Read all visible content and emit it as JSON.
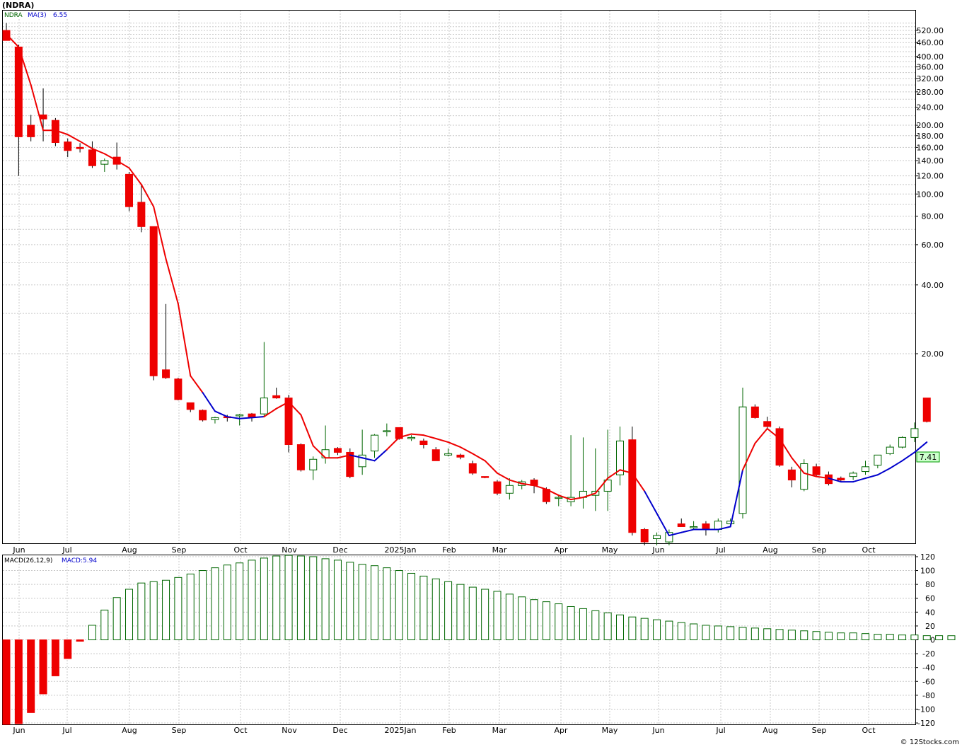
{
  "chart_data": [
    {
      "type": "candlestick",
      "ticker_title": "(NDRA)",
      "legend": {
        "symbol": "NDRA",
        "ma_label": "MA(3)",
        "ma_value": "6.55"
      },
      "last_price_label": "7.41",
      "y_scale": "log",
      "y_ticks": [
        "520.00",
        "460.00",
        "400.00",
        "360.00",
        "320.00",
        "280.00",
        "240.00",
        "200.00",
        "180.00",
        "160.00",
        "140.00",
        "120.00",
        "100.00",
        "80.00",
        "60.00",
        "40.00",
        "20.00"
      ],
      "month_labels": [
        "Jun",
        "Jul",
        "Aug",
        "Sep",
        "Oct",
        "Nov",
        "Dec",
        "2025Jan",
        "Feb",
        "Mar",
        "Apr",
        "May",
        "Jun",
        "Jul",
        "Aug",
        "Sep",
        "Oct"
      ],
      "colors": {
        "up": "#ffffff",
        "up_border": "#006600",
        "down": "#ee0000",
        "ma_down": "#ee0000",
        "ma_up": "#0000cc",
        "grid": "#c8c8c8"
      },
      "candles": [
        {
          "week": 0,
          "o": 520,
          "h": 560,
          "l": 470,
          "c": 470
        },
        {
          "week": 1,
          "o": 440,
          "h": 450,
          "l": 120,
          "c": 178
        },
        {
          "week": 2,
          "o": 200,
          "h": 222,
          "l": 170,
          "c": 178
        },
        {
          "week": 3,
          "o": 222,
          "h": 290,
          "l": 170,
          "c": 213
        },
        {
          "week": 4,
          "o": 210,
          "h": 215,
          "l": 162,
          "c": 168
        },
        {
          "week": 5,
          "o": 169,
          "h": 175,
          "l": 145,
          "c": 155
        },
        {
          "week": 6,
          "o": 160,
          "h": 167,
          "l": 152,
          "c": 158
        },
        {
          "week": 7,
          "o": 156,
          "h": 170,
          "l": 130,
          "c": 133
        },
        {
          "week": 8,
          "o": 135,
          "h": 143,
          "l": 125,
          "c": 140
        },
        {
          "week": 9,
          "o": 145,
          "h": 168,
          "l": 128,
          "c": 135
        },
        {
          "week": 10,
          "o": 122,
          "h": 125,
          "l": 84,
          "c": 88
        },
        {
          "week": 11,
          "o": 92,
          "h": 110,
          "l": 68,
          "c": 72
        },
        {
          "week": 12,
          "o": 72,
          "h": 72,
          "l": 15.3,
          "c": 16
        },
        {
          "week": 13,
          "o": 17,
          "h": 33,
          "l": 15.5,
          "c": 15.7
        },
        {
          "week": 14,
          "o": 15.5,
          "h": 15.7,
          "l": 12.5,
          "c": 12.6
        },
        {
          "week": 15,
          "o": 12.2,
          "h": 12.2,
          "l": 11.1,
          "c": 11.4
        },
        {
          "week": 16,
          "o": 11.3,
          "h": 11.4,
          "l": 10.1,
          "c": 10.25
        },
        {
          "week": 17,
          "o": 10.3,
          "h": 10.6,
          "l": 9.9,
          "c": 10.5
        },
        {
          "week": 18,
          "o": 10.6,
          "h": 10.8,
          "l": 10.1,
          "c": 10.5
        },
        {
          "week": 19,
          "o": 10.7,
          "h": 10.9,
          "l": 9.7,
          "c": 10.8
        },
        {
          "week": 20,
          "o": 10.9,
          "h": 11.0,
          "l": 10.1,
          "c": 10.5
        },
        {
          "week": 21,
          "o": 10.9,
          "h": 22.5,
          "l": 10.6,
          "c": 12.8
        },
        {
          "week": 22,
          "o": 13.1,
          "h": 14.2,
          "l": 12.7,
          "c": 12.8
        },
        {
          "week": 23,
          "o": 12.8,
          "h": 13.2,
          "l": 7.4,
          "c": 8.0
        },
        {
          "week": 24,
          "o": 8.0,
          "h": 8.1,
          "l": 6.1,
          "c": 6.2
        },
        {
          "week": 25,
          "o": 6.2,
          "h": 7.1,
          "l": 5.6,
          "c": 6.9
        },
        {
          "week": 26,
          "o": 7.0,
          "h": 9.7,
          "l": 6.6,
          "c": 7.6
        },
        {
          "week": 27,
          "o": 7.7,
          "h": 7.8,
          "l": 7.2,
          "c": 7.4
        },
        {
          "week": 28,
          "o": 7.4,
          "h": 7.7,
          "l": 5.7,
          "c": 5.8
        },
        {
          "week": 29,
          "o": 6.4,
          "h": 9.3,
          "l": 5.9,
          "c": 7.2
        },
        {
          "week": 30,
          "o": 7.5,
          "h": 8.9,
          "l": 7.0,
          "c": 8.8
        },
        {
          "week": 31,
          "o": 9.2,
          "h": 9.9,
          "l": 8.7,
          "c": 9.2
        },
        {
          "week": 32,
          "o": 9.5,
          "h": 9.5,
          "l": 8.4,
          "c": 8.5
        },
        {
          "week": 33,
          "o": 8.5,
          "h": 8.8,
          "l": 8.3,
          "c": 8.6
        },
        {
          "week": 34,
          "o": 8.3,
          "h": 8.5,
          "l": 7.7,
          "c": 8.0
        },
        {
          "week": 35,
          "o": 7.6,
          "h": 7.8,
          "l": 6.8,
          "c": 6.8
        },
        {
          "week": 36,
          "o": 7.2,
          "h": 7.7,
          "l": 7.1,
          "c": 7.3
        },
        {
          "week": 37,
          "o": 7.2,
          "h": 7.3,
          "l": 6.9,
          "c": 7.05
        },
        {
          "week": 38,
          "o": 6.6,
          "h": 6.8,
          "l": 5.9,
          "c": 6.0
        },
        {
          "week": 39,
          "o": 5.8,
          "h": 5.8,
          "l": 5.7,
          "c": 5.76
        },
        {
          "week": 40,
          "o": 5.5,
          "h": 5.6,
          "l": 4.8,
          "c": 4.9
        },
        {
          "week": 41,
          "o": 4.9,
          "h": 5.7,
          "l": 4.6,
          "c": 5.3
        },
        {
          "week": 42,
          "o": 5.3,
          "h": 5.6,
          "l": 5.1,
          "c": 5.5
        },
        {
          "week": 43,
          "o": 5.6,
          "h": 5.7,
          "l": 4.9,
          "c": 5.3
        },
        {
          "week": 44,
          "o": 5.1,
          "h": 5.2,
          "l": 4.4,
          "c": 4.5
        },
        {
          "week": 45,
          "o": 4.7,
          "h": 4.8,
          "l": 4.3,
          "c": 4.7
        },
        {
          "week": 46,
          "o": 4.5,
          "h": 8.8,
          "l": 4.3,
          "c": 4.7
        },
        {
          "week": 47,
          "o": 4.7,
          "h": 8.6,
          "l": 4.2,
          "c": 5.0
        },
        {
          "week": 48,
          "o": 4.8,
          "h": 7.7,
          "l": 4.1,
          "c": 5.0
        },
        {
          "week": 49,
          "o": 5.0,
          "h": 9.3,
          "l": 4.1,
          "c": 5.6
        },
        {
          "week": 50,
          "o": 5.9,
          "h": 9.6,
          "l": 5.3,
          "c": 8.3
        },
        {
          "week": 51,
          "o": 8.4,
          "h": 9.6,
          "l": 3.2,
          "c": 3.3
        },
        {
          "week": 52,
          "o": 3.4,
          "h": 3.45,
          "l": 2.9,
          "c": 3.0
        },
        {
          "week": 53,
          "o": 3.1,
          "h": 3.3,
          "l": 2.9,
          "c": 3.2
        },
        {
          "week": 54,
          "o": 3.0,
          "h": 3.4,
          "l": 2.9,
          "c": 3.3
        },
        {
          "week": 55,
          "o": 3.6,
          "h": 3.8,
          "l": 3.5,
          "c": 3.5
        },
        {
          "week": 56,
          "o": 3.5,
          "h": 3.7,
          "l": 3.4,
          "c": 3.5
        },
        {
          "week": 57,
          "o": 3.6,
          "h": 3.7,
          "l": 3.2,
          "c": 3.4
        },
        {
          "week": 58,
          "o": 3.4,
          "h": 3.8,
          "l": 3.3,
          "c": 3.7
        },
        {
          "week": 59,
          "o": 3.6,
          "h": 3.8,
          "l": 3.5,
          "c": 3.7
        },
        {
          "week": 60,
          "o": 4.0,
          "h": 14.2,
          "l": 3.8,
          "c": 11.7
        },
        {
          "week": 61,
          "o": 11.7,
          "h": 12.0,
          "l": 10.4,
          "c": 10.5
        },
        {
          "week": 62,
          "o": 10.1,
          "h": 10.6,
          "l": 9.3,
          "c": 9.6
        },
        {
          "week": 63,
          "o": 9.4,
          "h": 9.6,
          "l": 6.4,
          "c": 6.5
        },
        {
          "week": 64,
          "o": 6.2,
          "h": 6.4,
          "l": 5.2,
          "c": 5.6
        },
        {
          "week": 65,
          "o": 5.1,
          "h": 6.9,
          "l": 5.0,
          "c": 6.6
        },
        {
          "week": 66,
          "o": 6.4,
          "h": 6.6,
          "l": 5.8,
          "c": 5.9
        },
        {
          "week": 67,
          "o": 5.9,
          "h": 6.1,
          "l": 5.3,
          "c": 5.4
        },
        {
          "week": 68,
          "o": 5.7,
          "h": 5.8,
          "l": 5.5,
          "c": 5.6
        },
        {
          "week": 69,
          "o": 5.8,
          "h": 6.1,
          "l": 5.6,
          "c": 6.0
        },
        {
          "week": 70,
          "o": 6.1,
          "h": 6.8,
          "l": 5.9,
          "c": 6.4
        },
        {
          "week": 71,
          "o": 6.5,
          "h": 7.2,
          "l": 6.3,
          "c": 7.2
        },
        {
          "week": 72,
          "o": 7.3,
          "h": 8.0,
          "l": 7.2,
          "c": 7.8
        },
        {
          "week": 73,
          "o": 7.8,
          "h": 8.7,
          "l": 7.7,
          "c": 8.6
        },
        {
          "week": 74,
          "o": 8.6,
          "h": 10.0,
          "l": 8.2,
          "c": 9.4
        },
        {
          "week": 75,
          "o": 12.8,
          "h": 12.8,
          "l": 10.0,
          "c": 10.1
        }
      ],
      "ma3": [
        500,
        440,
        300,
        190,
        190,
        182,
        170,
        158,
        150,
        140,
        130,
        110,
        88,
        52,
        33,
        16,
        13.5,
        11.2,
        10.6,
        10.4,
        10.5,
        10.6,
        11.5,
        12.3,
        10.8,
        7.9,
        7.0,
        7.0,
        7.2,
        7.0,
        6.8,
        7.6,
        8.6,
        8.9,
        8.8,
        8.5,
        8.2,
        7.8,
        7.3,
        6.8,
        6.0,
        5.6,
        5.4,
        5.3,
        5.1,
        4.8,
        4.6,
        4.7,
        4.9,
        5.7,
        6.2,
        6.0,
        5.0,
        4.0,
        3.2,
        3.3,
        3.4,
        3.4,
        3.4,
        3.5,
        6.2,
        8.1,
        9.4,
        8.5,
        7.0,
        6.0,
        5.8,
        5.7,
        5.5,
        5.5,
        5.7,
        5.9,
        6.3,
        6.8,
        7.4,
        8.2
      ],
      "ma3_color_split_weeks": [
        [
          16,
          21,
          "up"
        ],
        [
          28,
          31,
          "up"
        ],
        [
          52,
          60,
          "up"
        ],
        [
          67,
          75,
          "up"
        ]
      ]
    },
    {
      "type": "bar",
      "legend": {
        "label": "MACD(26,12,9)",
        "value_label": "MACD:5.94"
      },
      "y_ticks": [
        "120",
        "100",
        "80",
        "60",
        "40",
        "20",
        "0",
        "-20",
        "-40",
        "-60",
        "-80",
        "-100",
        "-120"
      ],
      "ylim": [
        -122,
        122
      ],
      "values": [
        -122,
        -121,
        -105,
        -78,
        -52,
        -27,
        -2,
        21,
        43,
        61,
        73,
        82,
        84,
        86,
        90,
        95,
        100,
        104,
        108,
        111,
        115,
        118,
        121,
        122,
        121,
        120,
        117,
        115,
        112,
        109,
        107,
        104,
        100,
        96,
        92,
        88,
        84,
        80,
        76,
        73,
        70,
        66,
        62,
        58,
        55,
        52,
        48,
        45,
        42,
        39,
        36,
        33,
        31,
        29,
        27,
        25,
        23,
        21,
        20,
        19,
        18,
        17,
        16,
        15,
        14,
        13,
        12,
        11,
        10,
        10,
        9,
        8,
        8,
        7,
        7,
        6,
        6,
        5.94
      ]
    }
  ],
  "watermark": "© 12Stocks.com"
}
